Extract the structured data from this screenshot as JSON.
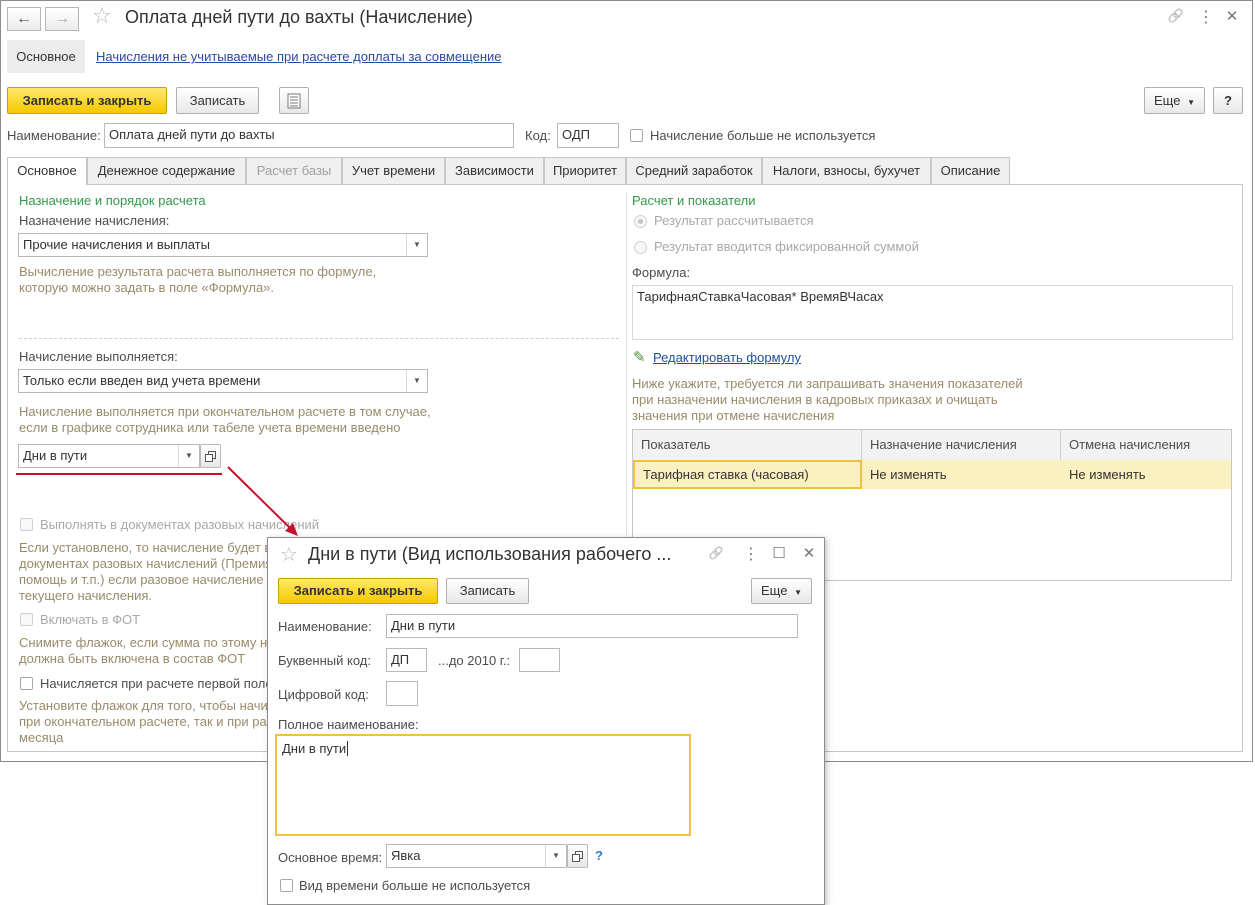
{
  "window": {
    "title": "Оплата дней пути до вахты (Начисление)",
    "back_glyph": "←",
    "forward_glyph": "→",
    "star_glyph": "☆",
    "link_glyph": "🔗",
    "more_glyph": "⋮",
    "close_glyph": "✕"
  },
  "top_nav": {
    "main_label": "Основное",
    "link_label": "Начисления не учитываемые при расчете доплаты за совмещение"
  },
  "toolbar": {
    "save_close": "Записать и закрыть",
    "save": "Записать",
    "more": "Еще",
    "help": "?"
  },
  "header_fields": {
    "name_label": "Наименование:",
    "name_value": "Оплата дней пути до вахты",
    "code_label": "Код:",
    "code_value": "ОДП",
    "not_used_label": "Начисление больше не используется"
  },
  "tabs": [
    {
      "label": "Основное"
    },
    {
      "label": "Денежное содержание"
    },
    {
      "label": "Расчет базы"
    },
    {
      "label": "Учет времени"
    },
    {
      "label": "Зависимости"
    },
    {
      "label": "Приоритет"
    },
    {
      "label": "Средний заработок"
    },
    {
      "label": "Налоги, взносы, бухучет"
    },
    {
      "label": "Описание"
    }
  ],
  "left": {
    "section_title": "Назначение и порядок расчета",
    "purpose_label": "Назначение начисления:",
    "purpose_value": "Прочие начисления и выплаты",
    "purpose_hint_1": "Вычисление результата расчета выполняется по формуле,",
    "purpose_hint_2": "которую можно задать в поле «Формула».",
    "performed_label": "Начисление выполняется:",
    "performed_value": "Только если введен вид учета времени",
    "performed_hint_1": "Начисление выполняется при окончательном расчете в том случае,",
    "performed_hint_2": "если в графике сотрудника или табеле учета времени введено",
    "time_kind_value": "Дни в пути",
    "one_time_label": "Выполнять в документах разовых начислений",
    "one_time_hint_1": "Если установлено, то начисление будет в",
    "one_time_hint_2": "документах разовых начислений (Премия",
    "one_time_hint_3": "помощь и т.п.) если разовое начисление",
    "one_time_hint_4": "текущего начисления.",
    "fot_label": "Включать в ФОТ",
    "fot_hint_1": "Снимите флажок, если сумма по этому на",
    "fot_hint_2": "должна быть включена в состав ФОТ",
    "first_half_label": "Начисляется при расчете первой поло",
    "first_half_hint_1": "Установите флажок для того, чтобы начис",
    "first_half_hint_2": "при окончательном расчете, так и при рас",
    "first_half_hint_3": "месяца"
  },
  "right": {
    "section_title": "Расчет и показатели",
    "radio_1": "Результат рассчитывается",
    "radio_2": "Результат вводится фиксированной суммой",
    "formula_label": "Формула:",
    "formula_value": "ТарифнаяСтавкаЧасовая*  ВремяВЧасах",
    "edit_formula": "Редактировать формулу",
    "pencil_glyph": "✎",
    "table_hint_1": "Ниже укажите, требуется ли запрашивать значения показателей",
    "table_hint_2": "при назначении начисления в кадровых приказах и очищать",
    "table_hint_3": "значения при отмене начисления",
    "table": {
      "headers": [
        "Показатель",
        "Назначение начисления",
        "Отмена начисления"
      ],
      "rows": [
        [
          "Тарифная ставка (часовая)",
          "Не изменять",
          "Не изменять"
        ]
      ]
    }
  },
  "dialog": {
    "title": "Дни в пути (Вид использования рабочего ...",
    "star_glyph": "☆",
    "link_glyph": "🔗",
    "more_glyph": "⋮",
    "max_glyph": "☐",
    "close_glyph": "✕",
    "save_close": "Записать и закрыть",
    "save": "Записать",
    "more": "Еще",
    "name_label": "Наименование:",
    "name_value": "Дни в пути",
    "letter_code_label": "Буквенный код:",
    "letter_code_value": "ДП",
    "before_2010_label": "...до 2010 г.:",
    "digit_code_label": "Цифровой код:",
    "full_name_label": "Полное наименование:",
    "full_name_value": "Дни в пути",
    "main_time_label": "Основное время:",
    "main_time_value": "Явка",
    "help": "?",
    "not_used_label": "Вид времени больше не используется"
  },
  "colors": {
    "accent_yellow": "#f6c800",
    "section_green": "#2f9b4a",
    "hint_brown": "#9a8a6a",
    "link_blue": "#1f4fa0",
    "arrow_red": "#c8102e",
    "selected_row": "#fbf0c0"
  }
}
